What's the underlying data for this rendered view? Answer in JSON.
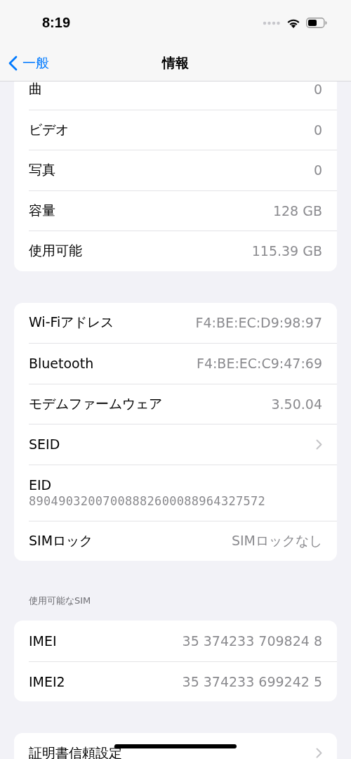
{
  "status_bar": {
    "time": "8:19"
  },
  "nav": {
    "back": "一般",
    "title": "情報"
  },
  "sections": [
    {
      "rows": [
        {
          "kind": "value",
          "label": "曲",
          "value": "0"
        },
        {
          "kind": "value",
          "label": "ビデオ",
          "value": "0"
        },
        {
          "kind": "value",
          "label": "写真",
          "value": "0"
        },
        {
          "kind": "value",
          "label": "容量",
          "value": "128 GB"
        },
        {
          "kind": "value",
          "label": "使用可能",
          "value": "115.39 GB"
        }
      ]
    },
    {
      "rows": [
        {
          "kind": "value",
          "label": "Wi-Fiアドレス",
          "value": "F4:BE:EC:D9:98:97"
        },
        {
          "kind": "value",
          "label": "Bluetooth",
          "value": "F4:BE:EC:C9:47:69"
        },
        {
          "kind": "value",
          "label": "モデムファームウェア",
          "value": "3.50.04"
        },
        {
          "kind": "chevron",
          "label": "SEID"
        },
        {
          "kind": "stacked",
          "label": "EID",
          "value": "89049032007008882600088964327572"
        },
        {
          "kind": "value",
          "label": "SIMロック",
          "value": "SIMロックなし"
        }
      ]
    },
    {
      "header": "使用可能なSIM",
      "rows": [
        {
          "kind": "value",
          "label": "IMEI",
          "value": "35 374233 709824 8"
        },
        {
          "kind": "value",
          "label": "IMEI2",
          "value": "35 374233 699242 5"
        }
      ]
    },
    {
      "rows": [
        {
          "kind": "chevron",
          "label": "証明書信頼設定"
        }
      ]
    }
  ]
}
